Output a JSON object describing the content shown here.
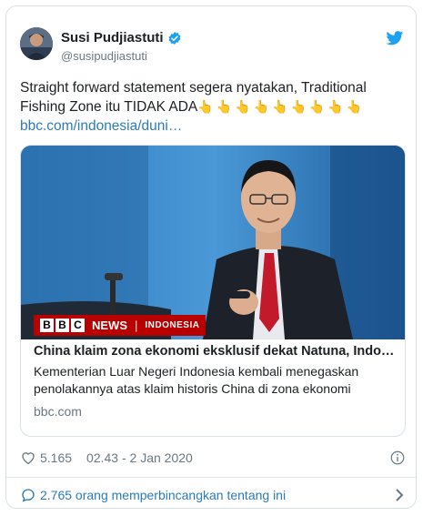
{
  "author": {
    "name": "Susi Pudjiastuti",
    "handle": "@susipudjiastuti"
  },
  "tweet": {
    "text": "Straight forward statement segera nyatakan, Traditional Fishing Zone itu TIDAK ADA",
    "emoji": "👆👆👆👆👆👆👆👆👆",
    "link": "bbc.com/indonesia/duni…"
  },
  "card": {
    "banner": {
      "blocks": [
        "B",
        "B",
        "C"
      ],
      "news": "NEWS",
      "separator": "|",
      "region": "INDONESIA"
    },
    "title": "China klaim zona ekonomi eksklusif dekat Natuna, Indon…",
    "description": "Kementerian Luar Negeri Indonesia kembali menegaskan penolakannya atas klaim historis China di zona ekonomi",
    "domain": "bbc.com"
  },
  "meta": {
    "likes": "5.165",
    "timestamp": "02.43 - 2 Jan 2020"
  },
  "conversation": {
    "label": "2.765 orang memperbincangkan tentang ini"
  },
  "icons": {
    "verified": "verified-badge-icon",
    "bird": "twitter-bird-icon",
    "heart": "heart-icon",
    "info": "info-icon",
    "bubble": "speech-bubble-icon",
    "chevron": "chevron-right-icon"
  },
  "colors": {
    "link": "#2b7bb9",
    "twitter_blue": "#1da1f2",
    "bbc_red": "#b80000",
    "muted": "#697882"
  }
}
